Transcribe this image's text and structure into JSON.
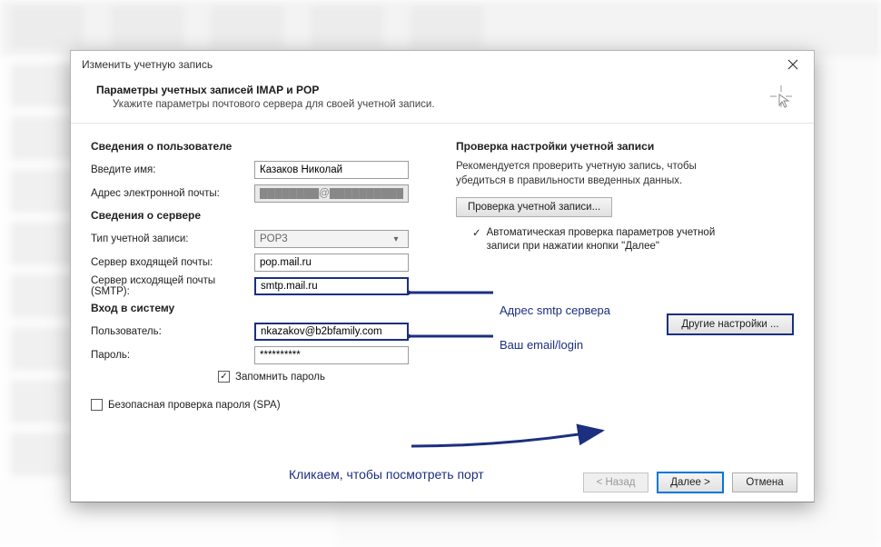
{
  "dialog": {
    "title": "Изменить учетную запись",
    "header": {
      "title": "Параметры учетных записей IMAP и POP",
      "subtitle": "Укажите параметры почтового сервера для своей учетной записи."
    },
    "sections": {
      "user_info": "Сведения о пользователе",
      "server_info": "Сведения о сервере",
      "login_info": "Вход в систему",
      "test_info": "Проверка настройки учетной записи"
    },
    "labels": {
      "name": "Введите имя:",
      "email": "Адрес электронной почты:",
      "account_type": "Тип учетной записи:",
      "incoming": "Сервер входящей почты:",
      "outgoing": "Сервер исходящей почты (SMTP):",
      "user": "Пользователь:",
      "password": "Пароль:"
    },
    "values": {
      "name": "Казаков Николай",
      "email_masked": "████████@██████████",
      "account_type": "POP3",
      "incoming": "pop.mail.ru",
      "outgoing": "smtp.mail.ru",
      "user": "nkazakov@b2bfamily.com",
      "password": "**********"
    },
    "checkboxes": {
      "remember_password": "Запомнить пароль",
      "spa": "Безопасная проверка пароля (SPA)",
      "auto_test": "Автоматическая проверка параметров учетной записи при нажатии кнопки \"Далее\""
    },
    "right": {
      "desc": "Рекомендуется проверить учетную запись, чтобы убедиться в правильности введенных данных.",
      "test_btn": "Проверка учетной записи...",
      "other_btn": "Другие настройки ..."
    },
    "footer": {
      "back": "< Назад",
      "next": "Далее >",
      "cancel": "Отмена"
    }
  },
  "annotations": {
    "smtp": "Адрес smtp сервера",
    "email": "Ваш email/login",
    "click": "Кликаем, чтобы посмотреть порт"
  }
}
